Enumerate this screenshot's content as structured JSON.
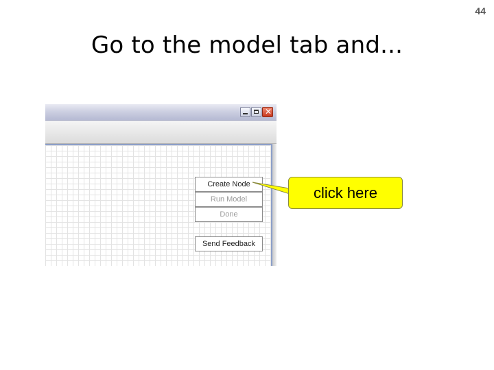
{
  "slide": {
    "number": "44",
    "title": "Go to the model tab and..."
  },
  "window": {
    "controls": {
      "minimize_icon": "minimize-icon",
      "maximize_icon": "maximize-icon",
      "close_icon": "close-icon",
      "close_glyph": "✕"
    },
    "buttons": {
      "create_node": "Create Node",
      "run_model": "Run Model",
      "done": "Done",
      "send_feedback": "Send Feedback"
    },
    "button_states": {
      "create_node": "enabled",
      "run_model": "disabled",
      "done": "disabled",
      "send_feedback": "enabled"
    }
  },
  "callout": {
    "text": "click here",
    "color": "#ffff00"
  },
  "colors": {
    "canvas_border": "#8c9fc9",
    "close_button": "#c8381e"
  }
}
